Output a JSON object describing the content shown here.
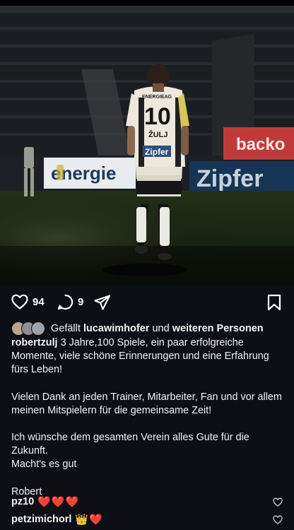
{
  "post": {
    "like_count": "94",
    "comment_count": "9"
  },
  "photo": {
    "jersey_sponsor": "ENERGIEAG",
    "jersey_number": "10",
    "jersey_name": "ŽULJ",
    "jersey_logo": "Zipfer",
    "board_left": "energie",
    "board_right": "Zipfer",
    "board_top_right": "backo"
  },
  "likes": {
    "prefix": "Gefällt",
    "user": "lucawimhofer",
    "middle": "und",
    "suffix": "weiteren Personen"
  },
  "caption": {
    "author": "robertzulj",
    "paragraphs": [
      "3 Jahre,100 Spiele, ein paar erfolgreiche Momente, viele schöne Erinnerungen und eine Erfahrung fürs Leben!",
      "Vielen Dank an jeden Trainer, Mitarbeiter, Fan und vor allem meinen Mitspielern für die gemeinsame Zeit!",
      "Ich wünsche dem gesamten Verein alles Gute für die Zukunft.\nMacht's es gut",
      "Robert"
    ]
  },
  "comments": [
    {
      "user": "pz10",
      "emoji": "❤️❤️❤️"
    },
    {
      "user": "petzimichorl",
      "emoji": "👑❤️"
    }
  ],
  "icons": [
    "heart-icon",
    "comment-icon",
    "share-icon",
    "bookmark-icon",
    "small-heart-icon"
  ],
  "colors": {
    "background": "#0c0f14",
    "text": "#f5f5f5",
    "heart_red": "#e0245e"
  }
}
